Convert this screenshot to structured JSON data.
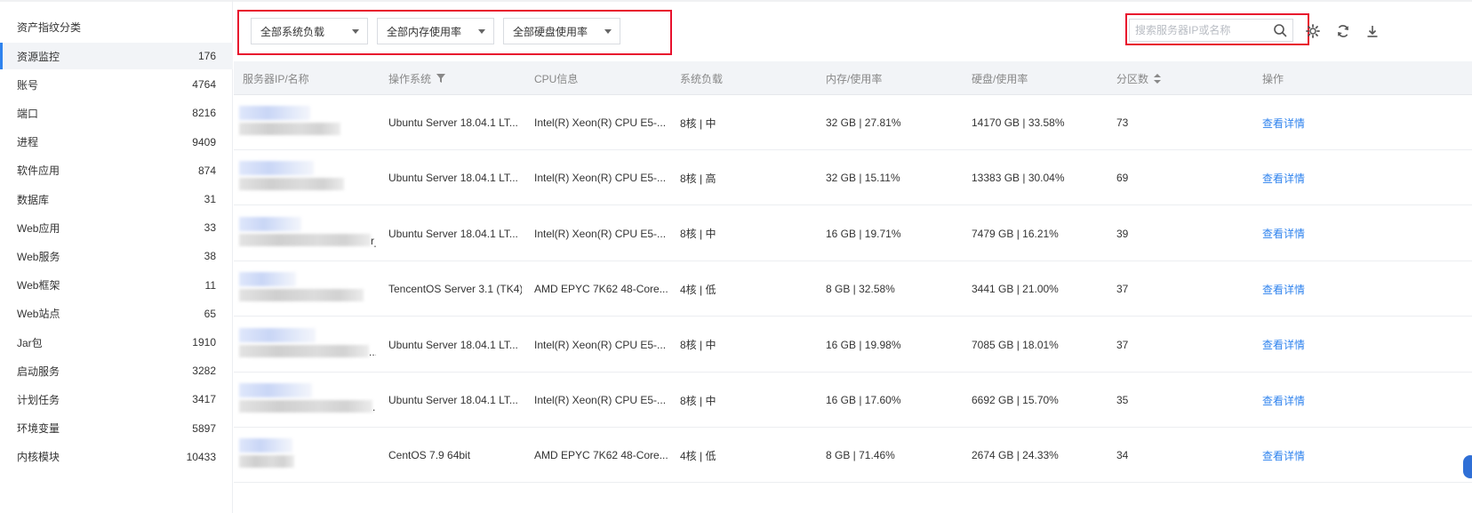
{
  "sidebar": {
    "title": "资产指纹分类",
    "items": [
      {
        "label": "资源监控",
        "count": "176",
        "active": true
      },
      {
        "label": "账号",
        "count": "4764"
      },
      {
        "label": "端口",
        "count": "8216"
      },
      {
        "label": "进程",
        "count": "9409"
      },
      {
        "label": "软件应用",
        "count": "874"
      },
      {
        "label": "数据库",
        "count": "31"
      },
      {
        "label": "Web应用",
        "count": "33"
      },
      {
        "label": "Web服务",
        "count": "38"
      },
      {
        "label": "Web框架",
        "count": "11"
      },
      {
        "label": "Web站点",
        "count": "65"
      },
      {
        "label": "Jar包",
        "count": "1910"
      },
      {
        "label": "启动服务",
        "count": "3282"
      },
      {
        "label": "计划任务",
        "count": "3417"
      },
      {
        "label": "环境变量",
        "count": "5897"
      },
      {
        "label": "内核模块",
        "count": "10433"
      }
    ]
  },
  "toolbar": {
    "filters": [
      {
        "label": "全部系统负载"
      },
      {
        "label": "全部内存使用率"
      },
      {
        "label": "全部硬盘使用率"
      }
    ],
    "search": {
      "placeholder": "搜索服务器IP或名称",
      "value": ""
    },
    "icons": [
      "search-icon",
      "settings-icon",
      "refresh-icon",
      "download-icon"
    ]
  },
  "table": {
    "columns": [
      "服务器IP/名称",
      "操作系统",
      "CPU信息",
      "系统负载",
      "内存/使用率",
      "硬盘/使用率",
      "分区数",
      "操作"
    ],
    "rows": [
      {
        "name_suffix": "",
        "os": "Ubuntu Server 18.04.1 LT...",
        "cpu": "Intel(R) Xeon(R) CPU E5-...",
        "load": "8核 | 中",
        "memory": "32 GB | 27.81%",
        "disk": "14170 GB | 33.58%",
        "partitions": "73",
        "action": "查看详情"
      },
      {
        "name_suffix": "",
        "os": "Ubuntu Server 18.04.1 LT...",
        "cpu": "Intel(R) Xeon(R) CPU E5-...",
        "load": "8核 | 高",
        "memory": "32 GB | 15.11%",
        "disk": "13383 GB | 30.04%",
        "partitions": "69",
        "action": "查看详情"
      },
      {
        "name_suffix": "r_...",
        "os": "Ubuntu Server 18.04.1 LT...",
        "cpu": "Intel(R) Xeon(R) CPU E5-...",
        "load": "8核 | 中",
        "memory": "16 GB | 19.71%",
        "disk": "7479 GB | 16.21%",
        "partitions": "39",
        "action": "查看详情"
      },
      {
        "name_suffix": "",
        "os": "TencentOS Server 3.1 (TK4)",
        "cpu": "AMD EPYC 7K62 48-Core...",
        "load": "4核 | 低",
        "memory": "8 GB | 32.58%",
        "disk": "3441 GB | 21.00%",
        "partitions": "37",
        "action": "查看详情"
      },
      {
        "name_suffix": "...",
        "os": "Ubuntu Server 18.04.1 LT...",
        "cpu": "Intel(R) Xeon(R) CPU E5-...",
        "load": "8核 | 中",
        "memory": "16 GB | 19.98%",
        "disk": "7085 GB | 18.01%",
        "partitions": "37",
        "action": "查看详情"
      },
      {
        "name_suffix": "..",
        "os": "Ubuntu Server 18.04.1 LT...",
        "cpu": "Intel(R) Xeon(R) CPU E5-...",
        "load": "8核 | 中",
        "memory": "16 GB | 17.60%",
        "disk": "6692 GB | 15.70%",
        "partitions": "35",
        "action": "查看详情"
      },
      {
        "name_suffix": "",
        "os": "CentOS 7.9 64bit",
        "cpu": "AMD EPYC 7K62 48-Core...",
        "load": "4核 | 低",
        "memory": "8 GB | 71.46%",
        "disk": "2674 GB | 24.33%",
        "partitions": "34",
        "action": "查看详情"
      }
    ]
  },
  "colors": {
    "accent": "#2f83ee",
    "highlight_box": "#e8112d",
    "header_bg": "#f2f4f7"
  }
}
